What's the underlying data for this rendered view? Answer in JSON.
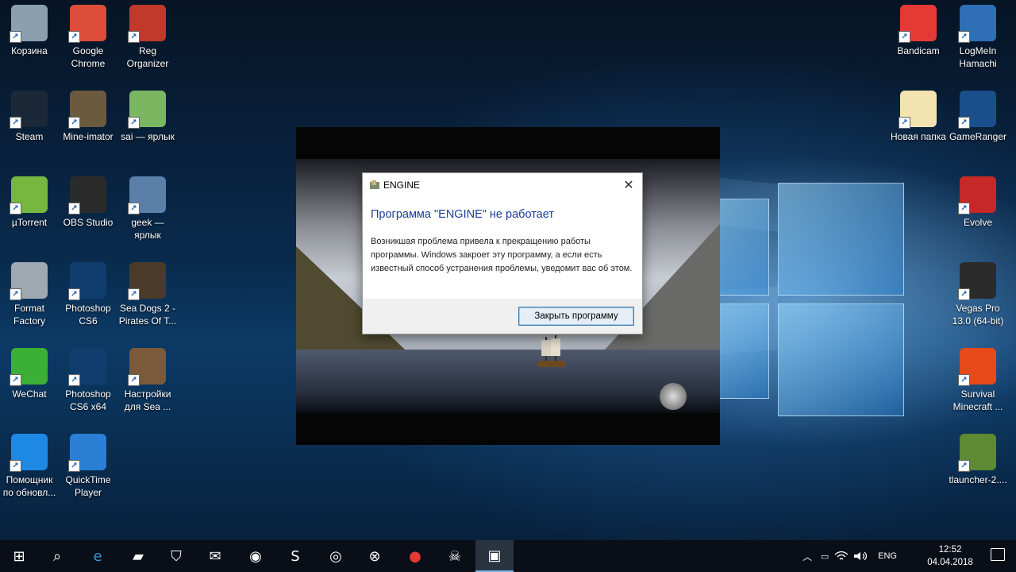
{
  "desktop": {
    "left_icons": [
      {
        "label": "Корзина",
        "icon": "recycle-bin-icon",
        "color": "#8aa0b0"
      },
      {
        "label": "Google Chrome",
        "icon": "chrome-icon",
        "color": "#dd4b39"
      },
      {
        "label": "Reg Organizer",
        "icon": "reg-organizer-icon",
        "color": "#c0392b"
      },
      {
        "label": "Steam",
        "icon": "steam-icon",
        "color": "#1b2838"
      },
      {
        "label": "Mine-imator",
        "icon": "mine-imator-icon",
        "color": "#6b5a3e"
      },
      {
        "label": "sai — ярлык",
        "icon": "sai-icon",
        "color": "#7bb661"
      },
      {
        "label": "µTorrent",
        "icon": "utorrent-icon",
        "color": "#76b83f"
      },
      {
        "label": "OBS Studio",
        "icon": "obs-icon",
        "color": "#2b2b2b"
      },
      {
        "label": "geek — ярлык",
        "icon": "geek-icon",
        "color": "#5a7fa8"
      },
      {
        "label": "Format Factory",
        "icon": "format-factory-icon",
        "color": "#9fa7b0"
      },
      {
        "label": "Photoshop CS6",
        "icon": "photoshop-icon",
        "color": "#0f3e6e"
      },
      {
        "label": "Sea Dogs 2 - Pirates Of T...",
        "icon": "skull-icon",
        "color": "#4a3a2a"
      },
      {
        "label": "WeChat",
        "icon": "wechat-icon",
        "color": "#3cb034"
      },
      {
        "label": "Photoshop CS6 x64",
        "icon": "photoshop-icon",
        "color": "#0f3e6e"
      },
      {
        "label": "Настройки для Sea ...",
        "icon": "settings-tools-icon",
        "color": "#7a5a3a"
      },
      {
        "label": "Помощник по обновл...",
        "icon": "windows-update-icon",
        "color": "#1e88e5"
      },
      {
        "label": "QuickTime Player",
        "icon": "quicktime-icon",
        "color": "#2a7fd4"
      }
    ],
    "right_icons": [
      {
        "label": "Bandicam",
        "icon": "bandicam-icon",
        "color": "#e53935"
      },
      {
        "label": "LogMeIn Hamachi",
        "icon": "hamachi-icon",
        "color": "#2f6fb5"
      },
      {
        "label": "Новая папка",
        "icon": "folder-icon",
        "color": "#f2e3b1"
      },
      {
        "label": "GameRanger",
        "icon": "gameranger-icon",
        "color": "#1a4f8b"
      },
      {
        "label": "Evolve",
        "icon": "evolve-icon",
        "color": "#c62828"
      },
      {
        "label": "Vegas Pro 13.0 (64-bit)",
        "icon": "vegas-icon",
        "color": "#2b2b2b"
      },
      {
        "label": "Survival Minecraft ...",
        "icon": "fire-icon",
        "color": "#e64a19"
      },
      {
        "label": "tlauncher-2....",
        "icon": "minecraft-block-icon",
        "color": "#5d8a32"
      }
    ]
  },
  "dialog": {
    "title": "ENGINE",
    "close_symbol": "✕",
    "heading": "Программа \"ENGINE\" не работает",
    "message": "Возникшая проблема привела к прекращению работы программы. Windows закроет эту программу, а если есть известный способ устранения проблемы, уведомит вас об этом.",
    "button": "Закрыть программу"
  },
  "taskbar": {
    "items": [
      {
        "name": "start-icon"
      },
      {
        "name": "search-icon"
      },
      {
        "name": "edge-icon"
      },
      {
        "name": "file-explorer-icon"
      },
      {
        "name": "store-icon"
      },
      {
        "name": "mail-icon"
      },
      {
        "name": "chrome-icon"
      },
      {
        "name": "skype-icon"
      },
      {
        "name": "groove-icon"
      },
      {
        "name": "xbox-icon"
      },
      {
        "name": "record-icon"
      },
      {
        "name": "sea-dogs-icon"
      },
      {
        "name": "engine-icon"
      }
    ],
    "tray": {
      "language": "ENG",
      "time": "12:52",
      "date": "04.04.2018"
    }
  }
}
